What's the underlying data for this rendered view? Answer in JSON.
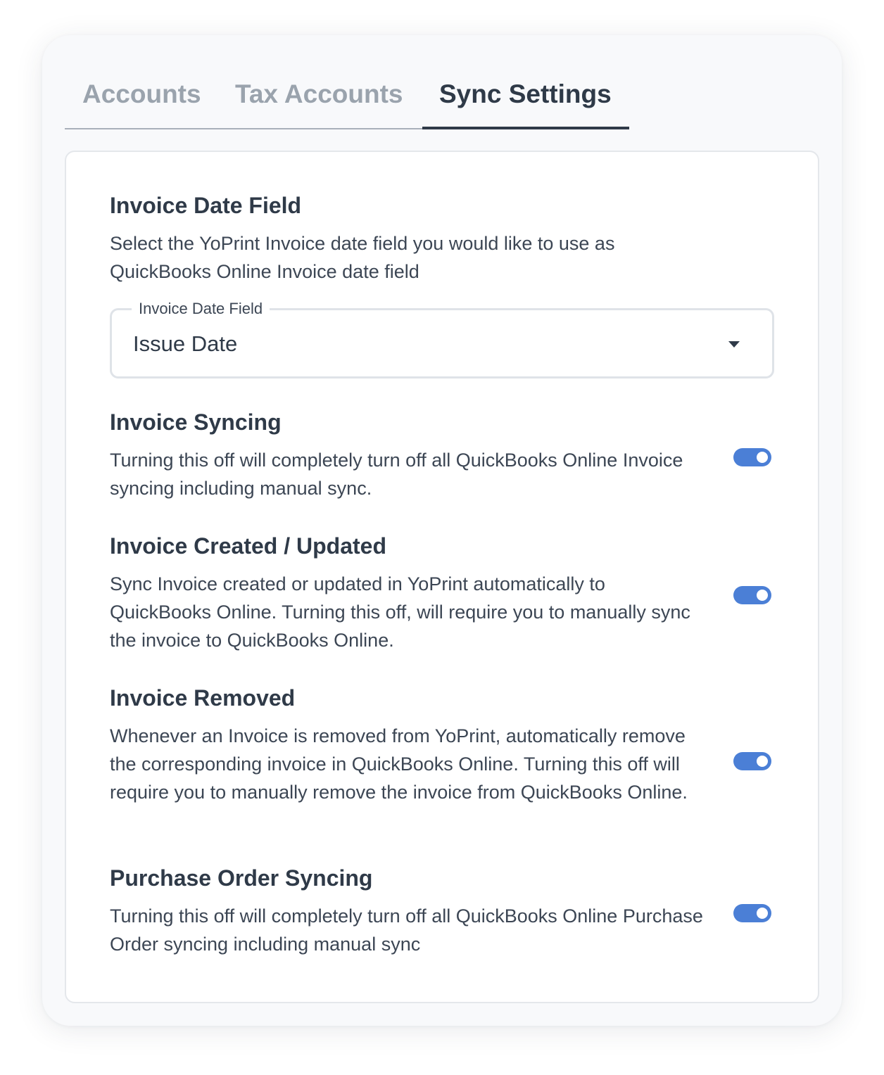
{
  "tabs": [
    {
      "label": "Accounts",
      "active": false
    },
    {
      "label": "Tax Accounts",
      "active": false
    },
    {
      "label": "Sync Settings",
      "active": true
    }
  ],
  "invoice_date": {
    "title": "Invoice Date Field",
    "description": "Select the YoPrint Invoice date field you would like to use as QuickBooks Online Invoice date field",
    "field_label": "Invoice Date Field",
    "field_value": "Issue Date"
  },
  "settings": [
    {
      "title": "Invoice Syncing",
      "description": "Turning this off will completely turn off all QuickBooks Online Invoice syncing including manual sync.",
      "enabled": true
    },
    {
      "title": "Invoice Created / Updated",
      "description": "Sync Invoice created or updated in YoPrint automatically to QuickBooks Online. Turning this off, will require you to manually sync the invoice to QuickBooks Online.",
      "enabled": true
    },
    {
      "title": "Invoice Removed",
      "description": "Whenever an Invoice is removed from YoPrint, automatically remove the corresponding invoice in QuickBooks Online. Turning this off will require you to manually remove the invoice from QuickBooks Online.",
      "enabled": true
    },
    {
      "title": "Purchase Order Syncing",
      "description": "Turning this off will completely turn off all QuickBooks Online Purchase Order syncing including manual sync",
      "enabled": true
    }
  ],
  "colors": {
    "toggle_on": "#4b7fd6",
    "text_primary": "#2f3a48",
    "tab_inactive": "#9aa3ad"
  }
}
